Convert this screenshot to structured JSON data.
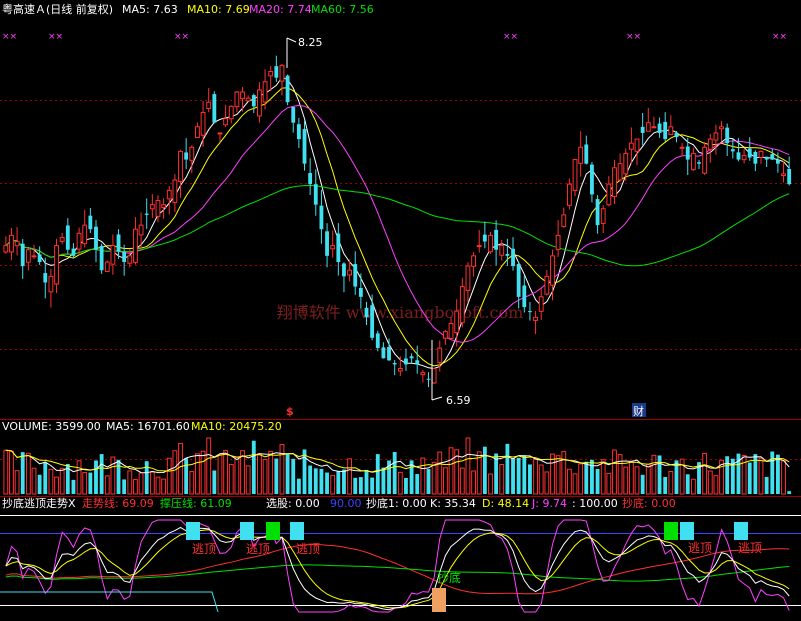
{
  "colors": {
    "bg": "#000000",
    "up": "#ff3030",
    "down": "#40e0f0",
    "ma5": "#ffffff",
    "ma10": "#ffff00",
    "ma20": "#ff40ff",
    "ma60": "#00e000",
    "grid": "#8b0000",
    "white": "#ffffff",
    "watermark": "#7a1e1e"
  },
  "header": {
    "stock": "粤高速Ａ(日线 前复权)",
    "ma5": "MA5: 7.63",
    "ma10": "MA10: 7.69",
    "ma20": "MA20: 7.74",
    "ma60": "MA60: 7.56"
  },
  "price": {
    "high_label": "8.25",
    "low_label": "6.59",
    "watermark": "翔博软件 www.xiangbosoft.com",
    "marker_s": "$",
    "marker_cai": "财",
    "x_marks": "××"
  },
  "volume_header": {
    "volume": "VOLUME: 3599.00",
    "ma5": "MA5: 16701.60",
    "ma10": "MA10: 20475.20"
  },
  "indicator_header": {
    "name": "抄底逃顶走势X",
    "trend": "走势线: 69.09",
    "pressure": "撑压线: 61.09",
    "select": "选股: 0.00",
    "ninety": "90.00",
    "bottom1": "抄底1: 0.00",
    "k": "K: 35.34",
    "d": "D: 48.14",
    "j": "J: 9.74",
    "hundred": ": 100.00",
    "bottom": "抄底: 0.00"
  },
  "indicator_labels": {
    "escape": "逃顶",
    "bottom": "抄底"
  },
  "chart_data": {
    "type": "candlestick",
    "title": "粤高速Ａ(日线 前复权)",
    "price_high": 8.25,
    "price_low": 6.59,
    "ma_last": {
      "MA5": 7.63,
      "MA10": 7.69,
      "MA20": 7.74,
      "MA60": 7.56
    },
    "close": [
      7.3,
      7.35,
      7.32,
      7.2,
      7.28,
      7.25,
      7.22,
      7.12,
      7.15,
      7.3,
      7.34,
      7.28,
      7.25,
      7.36,
      7.4,
      7.38,
      7.28,
      7.18,
      7.22,
      7.3,
      7.27,
      7.22,
      7.25,
      7.38,
      7.4,
      7.45,
      7.5,
      7.52,
      7.5,
      7.57,
      7.62,
      7.76,
      7.72,
      7.78,
      7.88,
      7.95,
      8.0,
      7.9,
      7.85,
      7.92,
      7.98,
      8.05,
      8.05,
      8.02,
      7.98,
      8.06,
      8.1,
      8.15,
      8.12,
      8.18,
      8.0,
      7.9,
      7.82,
      7.7,
      7.6,
      7.5,
      7.38,
      7.25,
      7.3,
      7.22,
      7.15,
      7.18,
      7.1,
      7.05,
      6.95,
      6.85,
      6.8,
      6.75,
      6.74,
      6.72,
      6.7,
      6.72,
      6.75,
      6.72,
      6.68,
      6.65,
      6.7,
      6.8,
      6.88,
      6.92,
      6.98,
      7.1,
      7.2,
      7.25,
      7.3,
      7.32,
      7.35,
      7.28,
      7.3,
      7.25,
      7.2,
      7.05,
      7.0,
      6.98,
      6.95,
      7.05,
      7.15,
      7.25,
      7.35,
      7.45,
      7.6,
      7.72,
      7.78,
      7.7,
      7.55,
      7.4,
      7.48,
      7.6,
      7.68,
      7.7,
      7.75,
      7.8,
      7.82,
      7.85,
      7.9,
      7.88,
      7.85,
      7.82,
      7.88,
      7.83,
      7.78,
      7.72,
      7.75,
      7.7,
      7.78,
      7.82,
      7.85,
      7.88,
      7.8,
      7.76,
      7.72,
      7.74,
      7.73,
      7.7,
      7.76,
      7.72,
      7.72,
      7.7,
      7.65,
      7.6
    ],
    "volume_last": 3599.0,
    "volume_ma": {
      "MA5": 16701.6,
      "MA10": 20475.2
    },
    "indicator": {
      "name": "抄底逃顶走势X",
      "走势线": 69.09,
      "撑压线": 61.09,
      "选股": 0.0,
      "level": 90.0,
      "抄底1": 0.0,
      "K": 35.34,
      "D": 48.14,
      "J": 9.74,
      "top_level": 100.0,
      "抄底": 0.0
    }
  }
}
